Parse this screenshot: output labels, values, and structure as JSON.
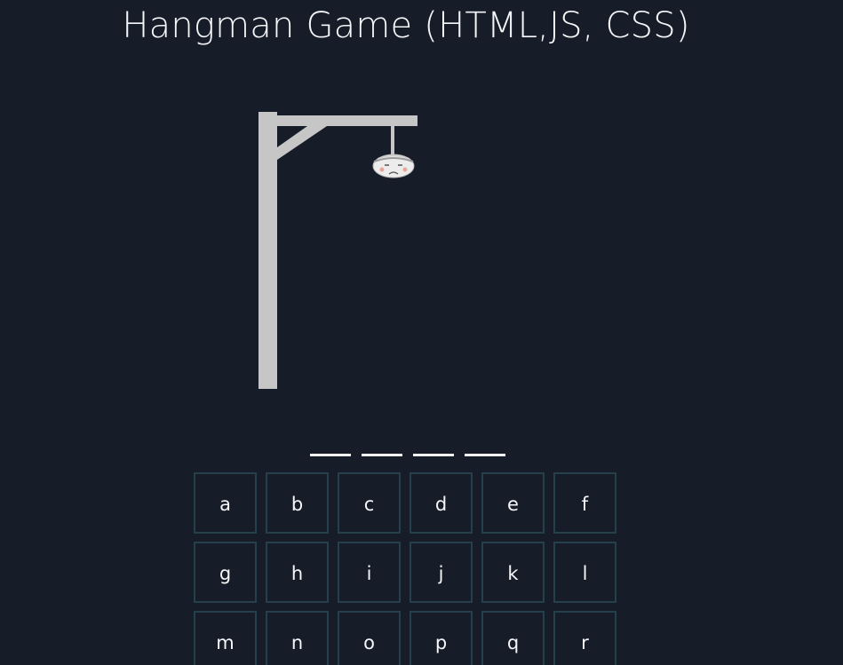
{
  "page": {
    "title": "Hangman Game (HTML,JS, CSS)"
  },
  "colors": {
    "background": "#171c29",
    "text": "#f4f6f8",
    "gallows": "#c6c6c6",
    "key_border": "#26404b",
    "word_blank": "#f1f3f5"
  },
  "hangman": {
    "parts_shown": [
      "gallows",
      "rope",
      "head"
    ]
  },
  "word": {
    "letters": [
      "",
      "",
      "",
      ""
    ]
  },
  "keyboard": {
    "keys": [
      {
        "label": "a"
      },
      {
        "label": "b"
      },
      {
        "label": "c"
      },
      {
        "label": "d"
      },
      {
        "label": "e"
      },
      {
        "label": "f"
      },
      {
        "label": "g"
      },
      {
        "label": "h"
      },
      {
        "label": "i"
      },
      {
        "label": "j"
      },
      {
        "label": "k"
      },
      {
        "label": "l"
      },
      {
        "label": "m"
      },
      {
        "label": "n"
      },
      {
        "label": "o"
      },
      {
        "label": "p"
      },
      {
        "label": "q"
      },
      {
        "label": "r"
      }
    ]
  }
}
